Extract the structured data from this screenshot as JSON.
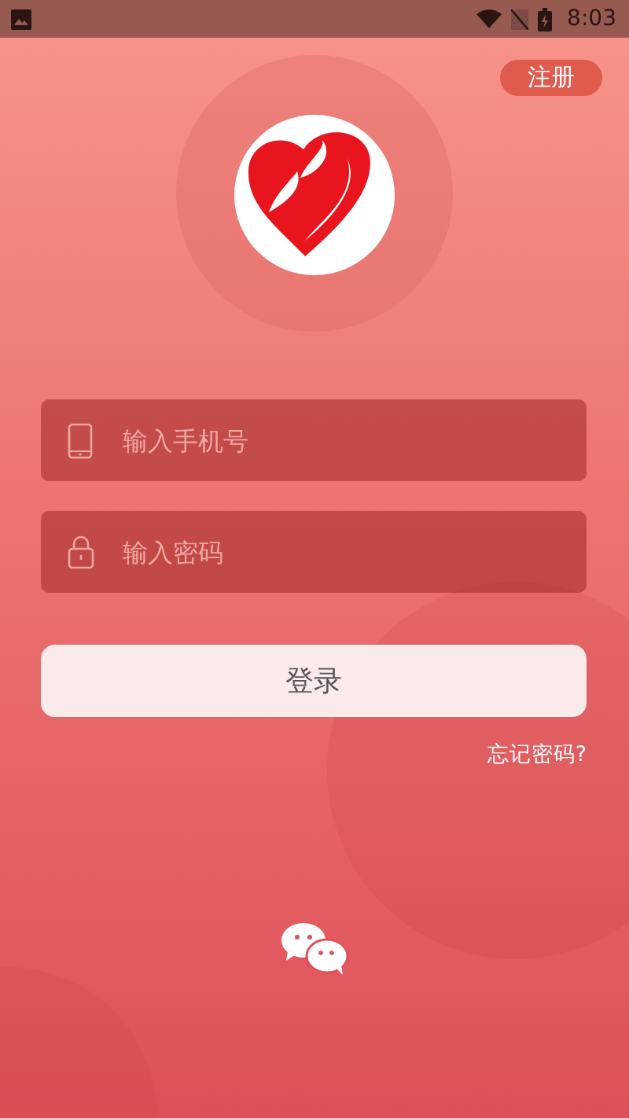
{
  "status_bar": {
    "time": "8:03"
  },
  "register_button": {
    "label": "注册"
  },
  "fields": [
    {
      "kind": "phone",
      "placeholder": "输入手机号"
    },
    {
      "kind": "password",
      "placeholder": "输入密码"
    }
  ],
  "login_button": {
    "label": "登录"
  },
  "forgot_link": {
    "label": "忘记密码?"
  }
}
